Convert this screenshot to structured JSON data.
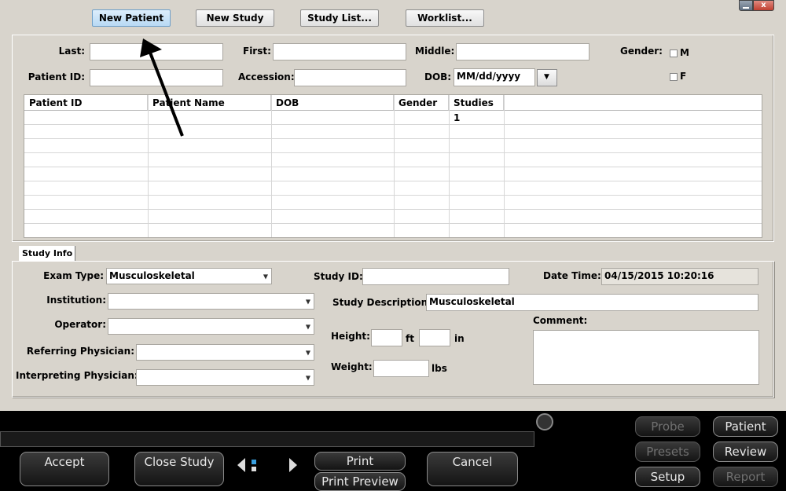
{
  "toolbar": {
    "new_patient": "New Patient",
    "new_study": "New Study",
    "study_list": "Study List...",
    "worklist": "Worklist..."
  },
  "patient_form": {
    "last_label": "Last:",
    "first_label": "First:",
    "middle_label": "Middle:",
    "gender_label": "Gender:",
    "gender_m": "M",
    "gender_f": "F",
    "patient_id_label": "Patient ID:",
    "accession_label": "Accession:",
    "dob_label": "DOB:",
    "dob_value": "MM/dd/yyyy"
  },
  "patient_table": {
    "columns": [
      "Patient ID",
      "Patient Name",
      "DOB",
      "Gender",
      "Studies"
    ],
    "rows": [
      {
        "patient_id": "",
        "patient_name": "",
        "dob": "",
        "gender": "",
        "studies": "1"
      }
    ]
  },
  "study_info": {
    "tab_label": "Study Info",
    "exam_type_label": "Exam Type:",
    "exam_type_value": "Musculoskeletal",
    "study_id_label": "Study ID:",
    "study_id_value": "",
    "date_time_label": "Date Time:",
    "date_time_value": "04/15/2015 10:20:16",
    "institution_label": "Institution:",
    "study_description_label": "Study Description:",
    "study_description_value": "Musculoskeletal",
    "operator_label": "Operator:",
    "comment_label": "Comment:",
    "height_label": "Height:",
    "height_ft_unit": "ft",
    "height_in_unit": "in",
    "referring_label": "Referring Physician:",
    "weight_label": "Weight:",
    "weight_unit": "lbs",
    "interpreting_label": "Interpreting Physician:"
  },
  "control_bar": {
    "accept": "Accept",
    "close_study": "Close Study",
    "print": "Print",
    "print_preview": "Print Preview",
    "cancel": "Cancel",
    "probe": "Probe",
    "patient": "Patient",
    "presets": "Presets",
    "review": "Review",
    "setup": "Setup",
    "report": "Report"
  },
  "colors": {
    "panel_bg": "#d8d4cc",
    "active_button": "#b8d9f4",
    "window_close": "#c75050"
  }
}
